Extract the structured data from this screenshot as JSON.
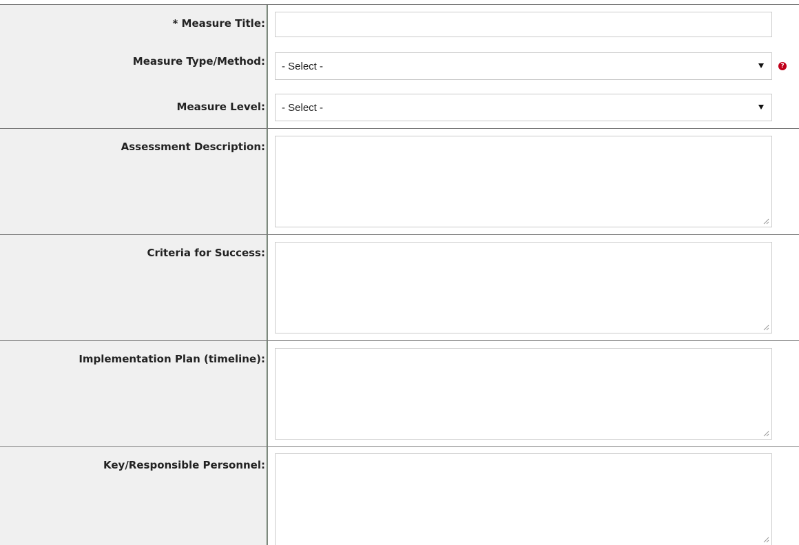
{
  "form": {
    "measure_title": {
      "label": "* Measure Title:",
      "value": ""
    },
    "measure_type_method": {
      "label": "Measure Type/Method:",
      "selected": "- Select -"
    },
    "measure_level": {
      "label": "Measure Level:",
      "selected": "- Select -"
    },
    "assessment_description": {
      "label": "Assessment Description:",
      "value": ""
    },
    "criteria_for_success": {
      "label": "Criteria for Success:",
      "value": ""
    },
    "implementation_plan": {
      "label": "Implementation Plan (timeline):",
      "value": ""
    },
    "key_responsible_personnel": {
      "label": "Key/Responsible Personnel:",
      "value": ""
    }
  },
  "help_icon": {
    "name": "help-icon",
    "glyph": "?",
    "color": "#c0001a"
  },
  "colors": {
    "label_background": "#f0f0f0",
    "border": "#7a7a7a",
    "input_border": "#c9c9c9"
  }
}
